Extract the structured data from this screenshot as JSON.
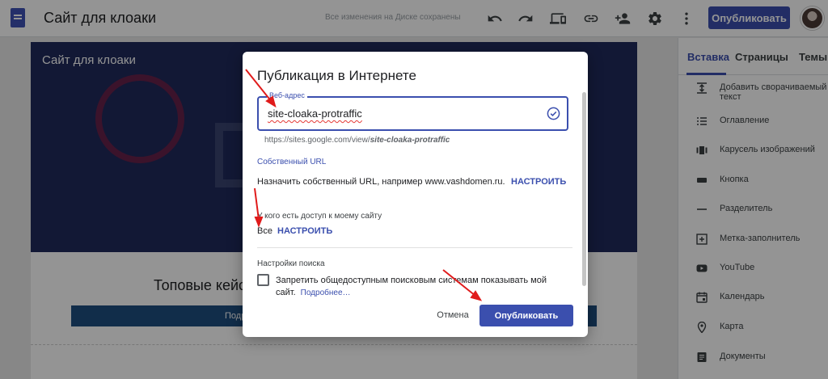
{
  "topbar": {
    "title": "Сайт для клоаки",
    "save_status": "Все изменения на Диске сохранены",
    "publish_label": "Опубликовать",
    "icons": [
      "undo-icon",
      "redo-icon",
      "preview-icon",
      "link-icon",
      "add-person-icon",
      "settings-icon",
      "more-vert-icon"
    ]
  },
  "canvas": {
    "hero_title": "Сайт для клоаки",
    "section_title": "Топовые кейс",
    "section_button": "Подр"
  },
  "panel": {
    "tabs": [
      {
        "label": "Вставка",
        "active": true
      },
      {
        "label": "Страницы",
        "active": false
      },
      {
        "label": "Темы",
        "active": false
      }
    ],
    "items": [
      {
        "label": "Добавить сворачиваемый текст",
        "icon": "collapsible-text-icon"
      },
      {
        "label": "Оглавление",
        "icon": "table-of-contents-icon"
      },
      {
        "label": "Карусель изображений",
        "icon": "carousel-icon"
      },
      {
        "label": "Кнопка",
        "icon": "button-icon"
      },
      {
        "label": "Разделитель",
        "icon": "divider-icon"
      },
      {
        "label": "Метка-заполнитель",
        "icon": "placeholder-icon"
      },
      {
        "label": "YouTube",
        "icon": "youtube-icon"
      },
      {
        "label": "Календарь",
        "icon": "calendar-icon"
      },
      {
        "label": "Карта",
        "icon": "map-pin-icon"
      },
      {
        "label": "Документы",
        "icon": "docs-icon"
      }
    ]
  },
  "dialog": {
    "title": "Публикация в Интернете",
    "web_address_label": "Веб-адрес",
    "web_address_value": "site-cloaka-protraffic",
    "url_prefix": "https://sites.google.com/view/",
    "url_slug": "site-cloaka-protraffic",
    "custom_url_heading": "Собственный URL",
    "custom_url_text": "Назначить собственный URL, например www.vashdomen.ru.",
    "custom_url_action": "НАСТРОИТЬ",
    "access_heading": "У кого есть доступ к моему сайту",
    "access_value": "Все",
    "access_action": "НАСТРОИТЬ",
    "search_heading": "Настройки поиска",
    "search_checkbox_text": "Запретить общедоступным поисковым системам показывать мой сайт.",
    "search_more_link": "Подробнее…",
    "search_checked": false,
    "cancel_label": "Отмена",
    "publish_label": "Опубликовать"
  },
  "colors": {
    "accent": "#3b4fae",
    "annotation_arrow": "#e01b1b",
    "hero_bg": "#1f2a5c"
  }
}
